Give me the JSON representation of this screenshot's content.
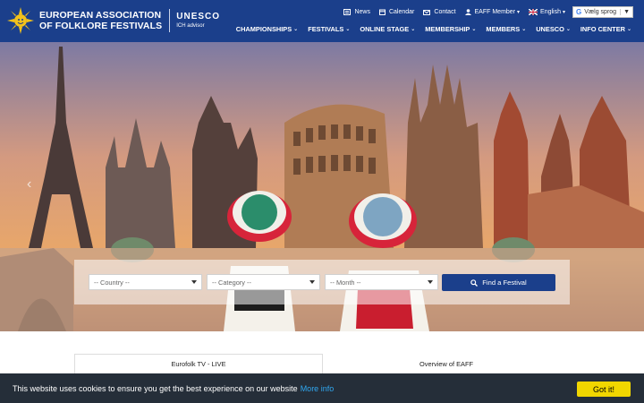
{
  "header": {
    "logo_line1": "EUROPEAN ASSOCIATION",
    "logo_line2": "OF FOLKLORE FESTIVALS",
    "unesco_title": "UNESCO",
    "unesco_sub": "ICH advisor"
  },
  "topbar": {
    "news": "News",
    "calendar": "Calendar",
    "contact": "Contact",
    "member": "EAFF Member",
    "language": "English",
    "translate_label": "Vælg sprog"
  },
  "nav": [
    {
      "label": "CHAMPIONSHIPS"
    },
    {
      "label": "FESTIVALS"
    },
    {
      "label": "ONLINE STAGE"
    },
    {
      "label": "MEMBERSHIP"
    },
    {
      "label": "MEMBERS"
    },
    {
      "label": "UNESCO"
    },
    {
      "label": "INFO CENTER"
    }
  ],
  "search": {
    "country_placeholder": "-- Country --",
    "category_placeholder": "-- Category --",
    "month_placeholder": "-- Month --",
    "find_label": "Find a Festival"
  },
  "tabs": {
    "left": "Eurofolk TV - LIVE",
    "right": "Overview of EAFF"
  },
  "cookie": {
    "message": "This website uses cookies to ensure you get the best experience on our website",
    "more": "More info",
    "button": "Got it!"
  },
  "colors": {
    "brand_blue": "#1b3f8b",
    "cookie_bg": "#252e39",
    "cookie_button": "#f1d600",
    "link": "#31a8f0"
  }
}
